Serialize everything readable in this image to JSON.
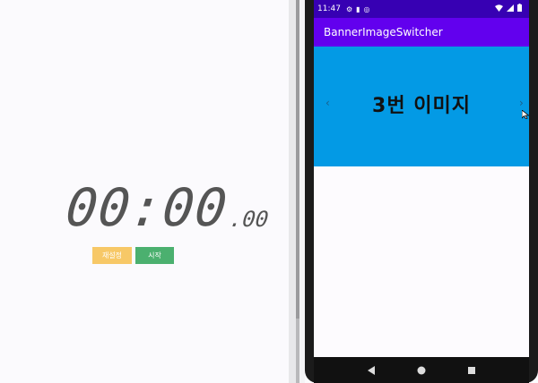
{
  "stopwatch": {
    "time_main": "00:00",
    "time_ms": ".00",
    "reset_label": "재설정",
    "start_label": "시작"
  },
  "phone": {
    "status_bar": {
      "time": "11:47"
    },
    "app_bar": {
      "title": "BannerImageSwitcher"
    },
    "banner": {
      "text": "3번 이미지",
      "background": "#039ae5",
      "prev_arrow": "‹",
      "next_arrow": "›"
    },
    "nav_bar": {
      "icons": [
        "back-icon",
        "home-icon",
        "recents-icon"
      ]
    }
  },
  "colors": {
    "status_bar": "#3700b3",
    "app_bar": "#6200ee",
    "reset_button": "#f7c867",
    "start_button": "#4bb06f"
  }
}
